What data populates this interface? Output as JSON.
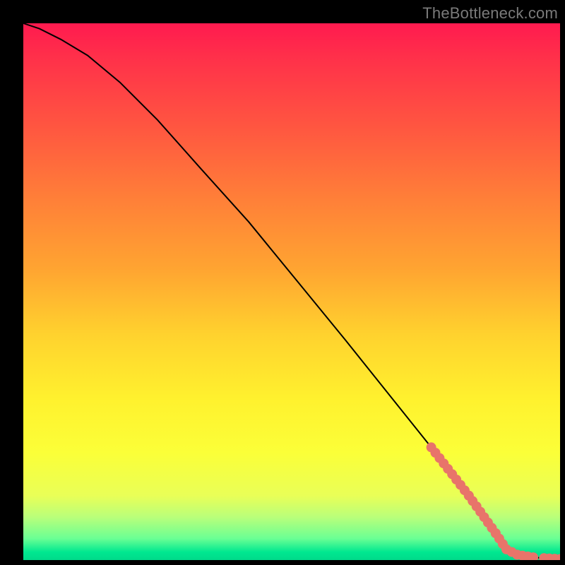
{
  "watermark": "TheBottleneck.com",
  "chart_data": {
    "type": "line",
    "title": "",
    "xlabel": "",
    "ylabel": "",
    "xlim": [
      0,
      100
    ],
    "ylim": [
      0,
      100
    ],
    "series": [
      {
        "name": "curve",
        "x": [
          0,
          3,
          7,
          12,
          18,
          25,
          33,
          42,
          51,
          60,
          68,
          76,
          83,
          88,
          90,
          92,
          95,
          98,
          100
        ],
        "y": [
          100,
          99,
          97,
          94,
          89,
          82,
          73,
          63,
          52,
          41,
          31,
          21,
          12,
          5,
          2,
          1,
          0.5,
          0.3,
          0.2
        ]
      }
    ],
    "marker_clusters": [
      {
        "x_start": 76,
        "x_end": 83,
        "count": 10,
        "color": "#e8746a"
      },
      {
        "x_start": 83,
        "x_end": 88,
        "count": 8,
        "color": "#e8746a"
      },
      {
        "x_start": 88,
        "x_end": 90,
        "count": 4,
        "color": "#e8746a"
      },
      {
        "x_start": 90,
        "x_end": 92,
        "count": 3,
        "color": "#e8746a"
      },
      {
        "x_start": 92,
        "x_end": 95,
        "count": 4,
        "color": "#e8746a"
      },
      {
        "x_start": 95,
        "x_end": 97,
        "count": 2,
        "color": "#e8746a"
      },
      {
        "x_start": 98,
        "x_end": 100,
        "count": 3,
        "color": "#e8746a"
      }
    ],
    "gradient_stops": [
      {
        "pos": 0.0,
        "color": "#ff1a4f"
      },
      {
        "pos": 0.2,
        "color": "#ff5840"
      },
      {
        "pos": 0.46,
        "color": "#ffa531"
      },
      {
        "pos": 0.7,
        "color": "#fff12e"
      },
      {
        "pos": 0.88,
        "color": "#e9ff57"
      },
      {
        "pos": 0.96,
        "color": "#6aff94"
      },
      {
        "pos": 1.0,
        "color": "#00da8a"
      }
    ]
  }
}
